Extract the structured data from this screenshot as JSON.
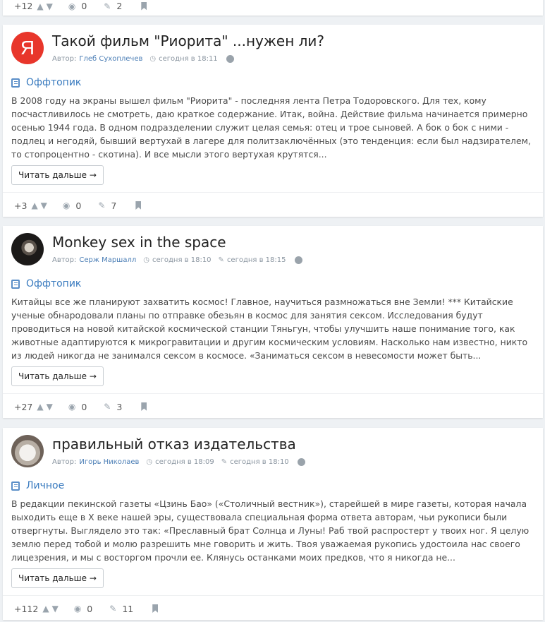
{
  "top_fragment": {
    "rating": "+12",
    "views": "0",
    "comments": "2"
  },
  "posts": [
    {
      "title": "Такой фильм \"Риорита\" ...нужен ли?",
      "author_prefix": "Автор:",
      "author": "Глеб Сухоплечев",
      "created": "сегодня в 18:11",
      "edited": "",
      "category": "Оффтопик",
      "avatar": "yandex-logo",
      "avatar_letter": "Я",
      "text": "В 2008 году на экраны вышел фильм \"Риорита\" - последняя лента Петра Тодоровского. Для тех, кому посчастливилось не смотреть, даю краткое содержание. Итак, война. Действие фильма начинается примерно осенью 1944 года. В одном подразделении служит целая семья: отец и трое сыновей. А бок о бок с ними - подлец и негодяй, бывший вертухай в лагере для политзаключённых (это тенденция: если был надзирателем, то стопроцентно - скотина). И все мысли этого вертухая крутятся...",
      "read_more": "Читать дальше →",
      "rating": "+3",
      "views": "0",
      "comments": "7"
    },
    {
      "title": "Monkey sex in the space",
      "author_prefix": "Автор:",
      "author": "Серж Маршалл",
      "created": "сегодня в 18:10",
      "edited": "сегодня в 18:15",
      "category": "Оффтопик",
      "avatar": "man-photo",
      "text": "Китайцы все же планируют захватить космос! Главное, научиться размножаться вне Земли! *** Китайские ученые обнародовали планы по отправке обезьян в космос для занятия сексом. Исследования будут проводиться на новой китайской космической станции Тяньгун, чтобы улучшить наше понимание того, как животные адаптируются к микрогравитации и другим космическим условиям. Насколько нам известно, никто из людей никогда не занимался сексом в космосе. «Заниматься сексом в невесомости может быть...",
      "read_more": "Читать дальше →",
      "rating": "+27",
      "views": "0",
      "comments": "3"
    },
    {
      "title": "правильный отказ издательства",
      "author_prefix": "Автор:",
      "author": "Игорь Николаев",
      "created": "сегодня в 18:09",
      "edited": "сегодня в 18:10",
      "category": "Личное",
      "avatar": "cat-photo",
      "text": "В редакции пекинской газеты «Цзинь Бао» («Столичный вестник»), старейшей в мире газеты, которая начала выходить еще в X веке нашей эры, существовала специальная форма ответа авторам, чьи рукописи были отвергнуты. Выглядело это так: «Преславный брат Солнца и Луны! Раб твой распростерт у твоих ног. Я целую землю перед тобой и молю разрешить мне говорить и жить. Твоя уважаемая рукопись удостоила нас своего лицезрения, и мы с восторгом прочли ее. Клянусь останками моих предков, что я никогда не...",
      "read_more": "Читать дальше →",
      "rating": "+112",
      "views": "0",
      "comments": "11"
    }
  ],
  "icons": {
    "clock": "clock-icon",
    "pencil": "pencil-icon",
    "globe": "globe-icon",
    "category": "notepad-icon",
    "thumb_up": "thumbs-up-icon",
    "thumb_down": "thumbs-down-icon",
    "eye": "eye-icon",
    "comments": "comments-icon",
    "bookmark": "bookmark-icon"
  },
  "colors": {
    "link": "#3a7bbf",
    "yandex_red": "#e8362b",
    "page_bg": "#eef1f4"
  }
}
